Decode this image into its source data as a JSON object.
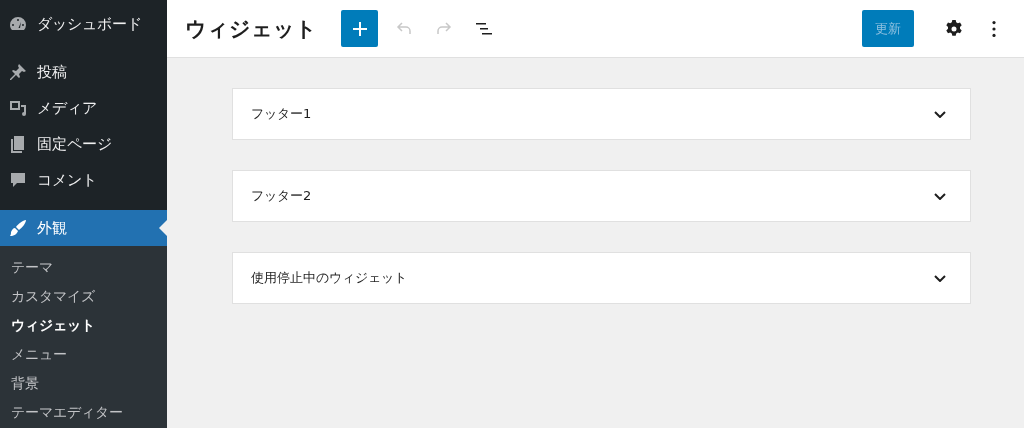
{
  "sidebar": {
    "items": [
      {
        "label": "ダッシュボード",
        "selected": false
      },
      {
        "label": "投稿",
        "selected": false
      },
      {
        "label": "メディア",
        "selected": false
      },
      {
        "label": "固定ページ",
        "selected": false
      },
      {
        "label": "コメント",
        "selected": false
      },
      {
        "label": "外観",
        "selected": true,
        "children": [
          {
            "label": "テーマ",
            "selected": false
          },
          {
            "label": "カスタマイズ",
            "selected": false
          },
          {
            "label": "ウィジェット",
            "selected": true
          },
          {
            "label": "メニュー",
            "selected": false
          },
          {
            "label": "背景",
            "selected": false
          },
          {
            "label": "テーマエディター",
            "selected": false
          }
        ]
      }
    ]
  },
  "header": {
    "title": "ウィジェット",
    "undo": {
      "disabled": true
    },
    "redo": {
      "disabled": true
    },
    "update_button": {
      "label": "更新",
      "disabled": true
    }
  },
  "widget_areas": [
    {
      "title": "フッター1",
      "expanded": false
    },
    {
      "title": "フッター2",
      "expanded": false
    },
    {
      "title": "使用停止中のウィジェット",
      "expanded": false
    }
  ]
}
